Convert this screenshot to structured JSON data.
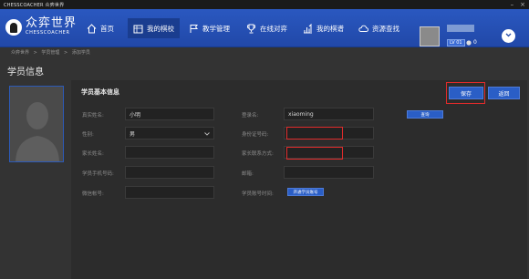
{
  "window": {
    "title": "CHESSCOACHER 众弈世界"
  },
  "logo": {
    "name_cn": "众弈世界",
    "name_en": "CHESSCOACHER"
  },
  "nav": {
    "items": [
      {
        "label": "首页",
        "icon": "home-icon",
        "active": false
      },
      {
        "label": "我的棋校",
        "icon": "school-icon",
        "active": true
      },
      {
        "label": "教学管理",
        "icon": "flag-icon",
        "active": false
      },
      {
        "label": "在线对弈",
        "icon": "trophy-icon",
        "active": false
      },
      {
        "label": "我的棋谱",
        "icon": "chart-icon",
        "active": false
      },
      {
        "label": "资源查找",
        "icon": "cloud-icon",
        "active": false
      }
    ]
  },
  "user": {
    "level": "LV 01",
    "coins": "0"
  },
  "breadcrumb": [
    "众弈世界",
    ">",
    "学员管理",
    ">",
    "添加学员"
  ],
  "page": {
    "title": "学员信息",
    "section_title": "学员基本信息",
    "save_label": "保存",
    "back_label": "返回",
    "query_label": "查询",
    "open_account_label": "开通学员账号"
  },
  "form": {
    "real_name_label": "真实姓名:",
    "real_name_value": "小明",
    "login_name_label": "登录名:",
    "login_name_value": "xiaoming",
    "gender_label": "性别:",
    "gender_value": "男",
    "id_number_label": "身份证号码:",
    "id_number_value": "",
    "parent_name_label": "家长姓名:",
    "parent_name_value": "",
    "parent_contact_label": "家长联系方式:",
    "parent_contact_value": "",
    "student_phone_label": "学员手机号码:",
    "student_phone_value": "",
    "email_label": "邮箱:",
    "email_value": "",
    "wechat_label": "微信帐号:",
    "wechat_value": "",
    "account_time_label": "学员账号时间:"
  },
  "colors": {
    "nav_blue": "#2148a8",
    "button_blue": "#2a5ec6",
    "highlight_red": "#e02b2b",
    "background": "#333333"
  }
}
